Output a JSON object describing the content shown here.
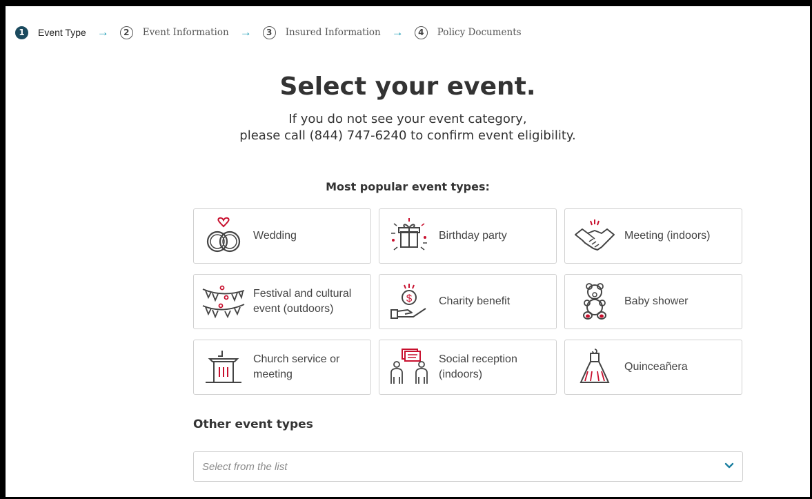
{
  "stepper": [
    {
      "num": "1",
      "label": "Event Type"
    },
    {
      "num": "2",
      "label": "Event Information"
    },
    {
      "num": "3",
      "label": "Insured Information"
    },
    {
      "num": "4",
      "label": "Policy Documents"
    }
  ],
  "header": {
    "title": "Select your event.",
    "subtitle_line1": "If you do not see your event category,",
    "subtitle_line2": "please call (844) 747-6240 to confirm event eligibility."
  },
  "popular": {
    "heading": "Most popular event types:",
    "cards": [
      {
        "label": "Wedding",
        "icon": "wedding-rings-icon"
      },
      {
        "label": "Birthday party",
        "icon": "gift-icon"
      },
      {
        "label": "Meeting (indoors)",
        "icon": "handshake-icon"
      },
      {
        "label": "Festival and cultural event (outdoors)",
        "icon": "bunting-icon"
      },
      {
        "label": "Charity benefit",
        "icon": "donation-hand-icon"
      },
      {
        "label": "Baby shower",
        "icon": "teddy-bear-icon"
      },
      {
        "label": "Church service or meeting",
        "icon": "pulpit-icon"
      },
      {
        "label": "Social reception (indoors)",
        "icon": "people-chat-icon"
      },
      {
        "label": "Quinceañera",
        "icon": "dress-icon"
      }
    ]
  },
  "other": {
    "heading": "Other event types",
    "placeholder": "Select from the list"
  },
  "colors": {
    "accent": "#1a9bb3",
    "icon_red": "#c8102e",
    "step_active": "#1b4a5e"
  }
}
